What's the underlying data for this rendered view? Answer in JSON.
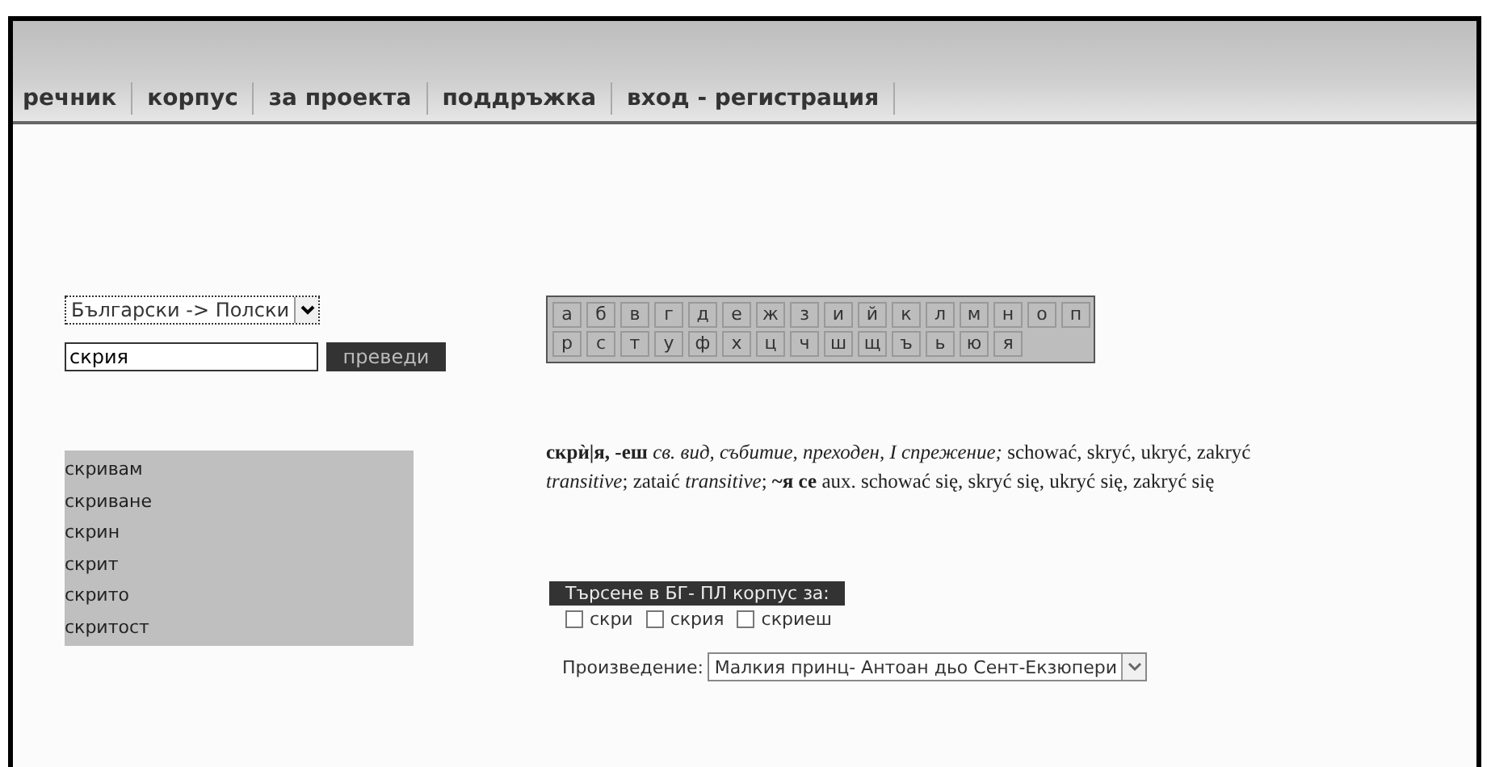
{
  "nav": [
    {
      "label": "речник"
    },
    {
      "label": "корпус"
    },
    {
      "label": "за проекта"
    },
    {
      "label": "поддръжка"
    },
    {
      "label": "вход - регистрация"
    }
  ],
  "direction": {
    "value": "Български -> Полски"
  },
  "search": {
    "value": "скрия",
    "button": "преведи"
  },
  "alphabet": [
    [
      "а",
      "б",
      "в",
      "г",
      "д",
      "е",
      "ж",
      "з",
      "и",
      "й",
      "к",
      "л",
      "м",
      "н",
      "о",
      "п"
    ],
    [
      "р",
      "с",
      "т",
      "у",
      "ф",
      "х",
      "ц",
      "ч",
      "ш",
      "щ",
      "ъ",
      "ь",
      "ю",
      "я"
    ]
  ],
  "suggestions": [
    "скривам",
    "скриване",
    "скрин",
    "скрит",
    "скрито",
    "скритост"
  ],
  "definition": "**скрѝ|я, -еш** *св. вид, събитие, преходен, I спрежение;* schować, skryć, ukryć, zakryć *transitive*; zataić *transitive*; **~я се** aux. schować się, skryć się, ukryć się, zakryć się",
  "corpus": {
    "title": "Търсене в БГ- ПЛ корпус за:",
    "forms": [
      {
        "label": "скри",
        "checked": false
      },
      {
        "label": "скрия",
        "checked": false
      },
      {
        "label": "скриеш",
        "checked": false
      }
    ],
    "work_label": "Произведение:",
    "work": "Малкия принц- Антоан дьо Сент-Екзюпери"
  }
}
